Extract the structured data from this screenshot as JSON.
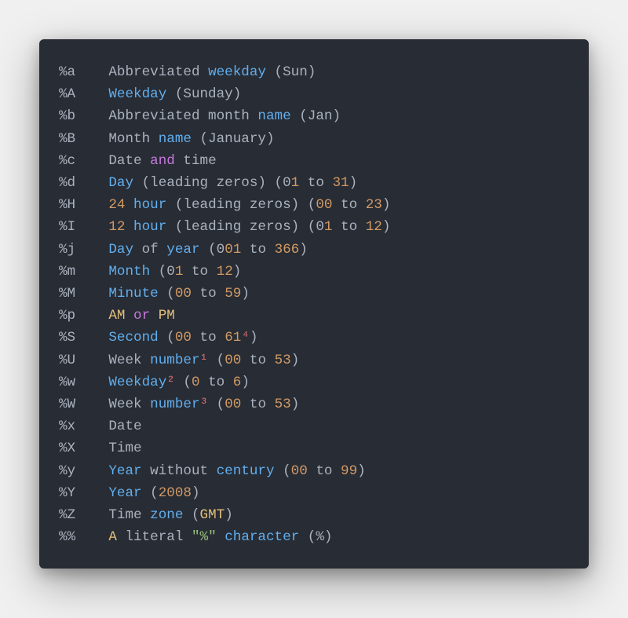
{
  "card": {
    "lines": [
      {
        "code": "%a",
        "tokens": [
          {
            "t": "Abbreviated ",
            "c": "grey"
          },
          {
            "t": "weekday",
            "c": "blue"
          },
          {
            "t": " (Sun)",
            "c": "grey"
          }
        ]
      },
      {
        "code": "%A",
        "tokens": [
          {
            "t": "Weekday",
            "c": "blue"
          },
          {
            "t": " (Sunday)",
            "c": "grey"
          }
        ]
      },
      {
        "code": "%b",
        "tokens": [
          {
            "t": "Abbreviated month ",
            "c": "grey"
          },
          {
            "t": "name",
            "c": "blue"
          },
          {
            "t": " (Jan)",
            "c": "grey"
          }
        ]
      },
      {
        "code": "%B",
        "tokens": [
          {
            "t": "Month ",
            "c": "grey"
          },
          {
            "t": "name",
            "c": "blue"
          },
          {
            "t": " (January)",
            "c": "grey"
          }
        ]
      },
      {
        "code": "%c",
        "tokens": [
          {
            "t": "Date ",
            "c": "grey"
          },
          {
            "t": "and",
            "c": "mag"
          },
          {
            "t": " time",
            "c": "grey"
          }
        ]
      },
      {
        "code": "%d",
        "tokens": [
          {
            "t": "Day",
            "c": "blue"
          },
          {
            "t": " (leading zeros) (",
            "c": "grey"
          },
          {
            "t": "0",
            "c": "grey"
          },
          {
            "t": "1",
            "c": "gold"
          },
          {
            "t": " to ",
            "c": "grey"
          },
          {
            "t": "31",
            "c": "gold"
          },
          {
            "t": ")",
            "c": "grey"
          }
        ]
      },
      {
        "code": "%H",
        "tokens": [
          {
            "t": "24",
            "c": "gold"
          },
          {
            "t": " ",
            "c": "grey"
          },
          {
            "t": "hour",
            "c": "blue"
          },
          {
            "t": " (leading zeros) (",
            "c": "grey"
          },
          {
            "t": "00",
            "c": "gold"
          },
          {
            "t": " to ",
            "c": "grey"
          },
          {
            "t": "23",
            "c": "gold"
          },
          {
            "t": ")",
            "c": "grey"
          }
        ]
      },
      {
        "code": "%I",
        "tokens": [
          {
            "t": "12",
            "c": "gold"
          },
          {
            "t": " ",
            "c": "grey"
          },
          {
            "t": "hour",
            "c": "blue"
          },
          {
            "t": " (leading zeros) (",
            "c": "grey"
          },
          {
            "t": "0",
            "c": "grey"
          },
          {
            "t": "1",
            "c": "gold"
          },
          {
            "t": " to ",
            "c": "grey"
          },
          {
            "t": "12",
            "c": "gold"
          },
          {
            "t": ")",
            "c": "grey"
          }
        ]
      },
      {
        "code": "%j",
        "tokens": [
          {
            "t": "Day",
            "c": "blue"
          },
          {
            "t": " of ",
            "c": "grey"
          },
          {
            "t": "year",
            "c": "blue"
          },
          {
            "t": " (",
            "c": "grey"
          },
          {
            "t": "0",
            "c": "grey"
          },
          {
            "t": "0",
            "c": "gold"
          },
          {
            "t": "1",
            "c": "gold"
          },
          {
            "t": " to ",
            "c": "grey"
          },
          {
            "t": "366",
            "c": "gold"
          },
          {
            "t": ")",
            "c": "grey"
          }
        ]
      },
      {
        "code": "%m",
        "tokens": [
          {
            "t": "Month",
            "c": "blue"
          },
          {
            "t": " (",
            "c": "grey"
          },
          {
            "t": "0",
            "c": "grey"
          },
          {
            "t": "1",
            "c": "gold"
          },
          {
            "t": " to ",
            "c": "grey"
          },
          {
            "t": "12",
            "c": "gold"
          },
          {
            "t": ")",
            "c": "grey"
          }
        ]
      },
      {
        "code": "%M",
        "tokens": [
          {
            "t": "Minute",
            "c": "blue"
          },
          {
            "t": " (",
            "c": "grey"
          },
          {
            "t": "00",
            "c": "gold"
          },
          {
            "t": " to ",
            "c": "grey"
          },
          {
            "t": "59",
            "c": "gold"
          },
          {
            "t": ")",
            "c": "grey"
          }
        ]
      },
      {
        "code": "%p",
        "tokens": [
          {
            "t": "AM",
            "c": "yellow"
          },
          {
            "t": " ",
            "c": "grey"
          },
          {
            "t": "or",
            "c": "mag"
          },
          {
            "t": " ",
            "c": "grey"
          },
          {
            "t": "PM",
            "c": "yellow"
          }
        ]
      },
      {
        "code": "%S",
        "tokens": [
          {
            "t": "Second",
            "c": "blue"
          },
          {
            "t": " (",
            "c": "grey"
          },
          {
            "t": "00",
            "c": "gold"
          },
          {
            "t": " to ",
            "c": "grey"
          },
          {
            "t": "61",
            "c": "gold"
          },
          {
            "t": "⁴",
            "c": "red"
          },
          {
            "t": ")",
            "c": "grey"
          }
        ]
      },
      {
        "code": "%U",
        "tokens": [
          {
            "t": "Week ",
            "c": "grey"
          },
          {
            "t": "number",
            "c": "blue"
          },
          {
            "t": "¹",
            "c": "red"
          },
          {
            "t": " (",
            "c": "grey"
          },
          {
            "t": "00",
            "c": "gold"
          },
          {
            "t": " to ",
            "c": "grey"
          },
          {
            "t": "53",
            "c": "gold"
          },
          {
            "t": ")",
            "c": "grey"
          }
        ]
      },
      {
        "code": "%w",
        "tokens": [
          {
            "t": "Weekday",
            "c": "blue"
          },
          {
            "t": "²",
            "c": "red"
          },
          {
            "t": " (",
            "c": "grey"
          },
          {
            "t": "0",
            "c": "gold"
          },
          {
            "t": " to ",
            "c": "grey"
          },
          {
            "t": "6",
            "c": "gold"
          },
          {
            "t": ")",
            "c": "grey"
          }
        ]
      },
      {
        "code": "%W",
        "tokens": [
          {
            "t": "Week ",
            "c": "grey"
          },
          {
            "t": "number",
            "c": "blue"
          },
          {
            "t": "³",
            "c": "red"
          },
          {
            "t": " (",
            "c": "grey"
          },
          {
            "t": "00",
            "c": "gold"
          },
          {
            "t": " to ",
            "c": "grey"
          },
          {
            "t": "53",
            "c": "gold"
          },
          {
            "t": ")",
            "c": "grey"
          }
        ]
      },
      {
        "code": "%x",
        "tokens": [
          {
            "t": "Date",
            "c": "grey"
          }
        ]
      },
      {
        "code": "%X",
        "tokens": [
          {
            "t": "Time",
            "c": "grey"
          }
        ]
      },
      {
        "code": "%y",
        "tokens": [
          {
            "t": "Year",
            "c": "blue"
          },
          {
            "t": " without ",
            "c": "grey"
          },
          {
            "t": "century",
            "c": "blue"
          },
          {
            "t": " (",
            "c": "grey"
          },
          {
            "t": "00",
            "c": "gold"
          },
          {
            "t": " to ",
            "c": "grey"
          },
          {
            "t": "99",
            "c": "gold"
          },
          {
            "t": ")",
            "c": "grey"
          }
        ]
      },
      {
        "code": "%Y",
        "tokens": [
          {
            "t": "Year",
            "c": "blue"
          },
          {
            "t": " (",
            "c": "grey"
          },
          {
            "t": "2008",
            "c": "gold"
          },
          {
            "t": ")",
            "c": "grey"
          }
        ]
      },
      {
        "code": "%Z",
        "tokens": [
          {
            "t": "Time ",
            "c": "grey"
          },
          {
            "t": "zone",
            "c": "blue"
          },
          {
            "t": " (",
            "c": "grey"
          },
          {
            "t": "GMT",
            "c": "yellow"
          },
          {
            "t": ")",
            "c": "grey"
          }
        ]
      },
      {
        "code": "%%",
        "tokens": [
          {
            "t": "A",
            "c": "yellow"
          },
          {
            "t": " literal ",
            "c": "grey"
          },
          {
            "t": "\"%\"",
            "c": "green"
          },
          {
            "t": " ",
            "c": "grey"
          },
          {
            "t": "character",
            "c": "blue"
          },
          {
            "t": " (%)",
            "c": "grey"
          }
        ]
      }
    ]
  }
}
